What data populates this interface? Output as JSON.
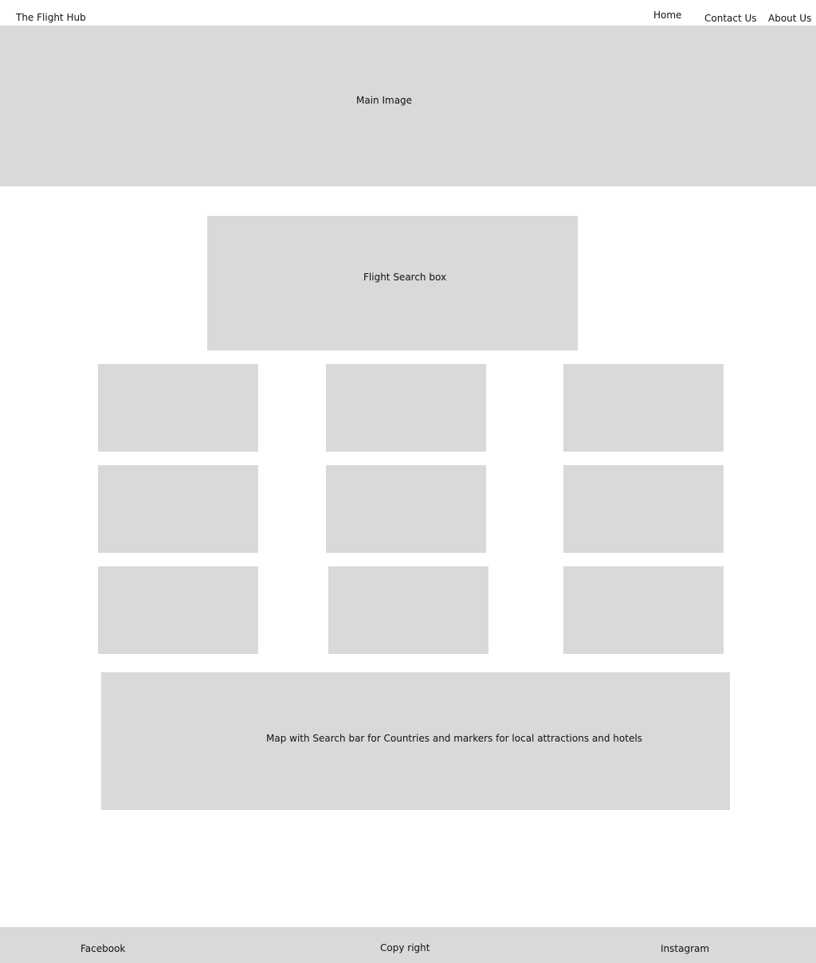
{
  "header": {
    "brand": "The Flight Hub",
    "nav": {
      "home": "Home",
      "contact": "Contact Us",
      "about": "About Us"
    }
  },
  "hero": {
    "label": "Main Image"
  },
  "search": {
    "label": "Flight Search box"
  },
  "map": {
    "label": "Map with Search bar for Countries and markers for local attractions and hotels"
  },
  "footer": {
    "facebook": "Facebook",
    "copyright": "Copy right",
    "instagram": "Instagram"
  },
  "colors": {
    "placeholder": "#d9d9d9",
    "background": "#ffffff",
    "text": "#111111"
  }
}
